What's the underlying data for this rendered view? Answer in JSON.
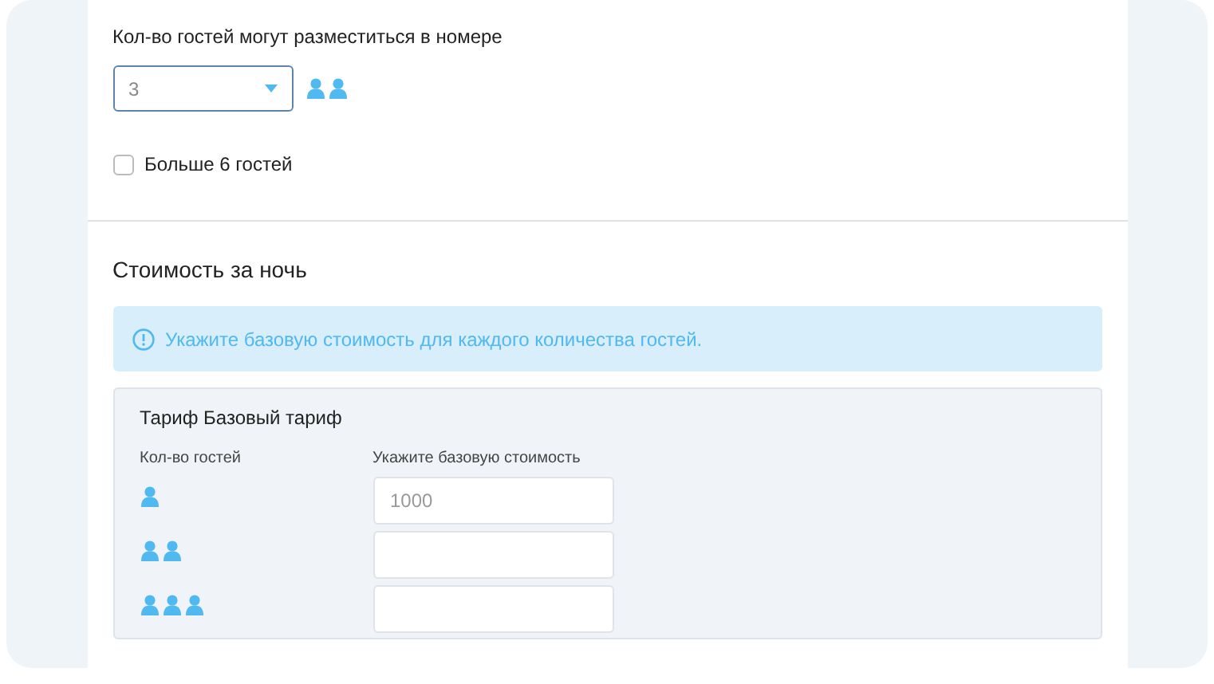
{
  "guests": {
    "label": "Кол-во гостей могут разместиться в номере",
    "select": {
      "value": "3"
    },
    "kind": "two"
  },
  "more_guests": {
    "label": "Больше 6 гостей",
    "checked": false
  },
  "price": {
    "title": "Стоимость за ночь",
    "alert": "Укажите базовую стоимость для каждого количества гостей.",
    "tariff": {
      "title": "Тариф Базовый тариф",
      "columns": [
        "Кол-во гостей",
        "Укажите базовую стоимость"
      ],
      "rows": [
        {
          "kind": "one",
          "placeholder": "1000"
        },
        {
          "kind": "two"
        },
        {
          "kind": "three"
        }
      ]
    }
  }
}
